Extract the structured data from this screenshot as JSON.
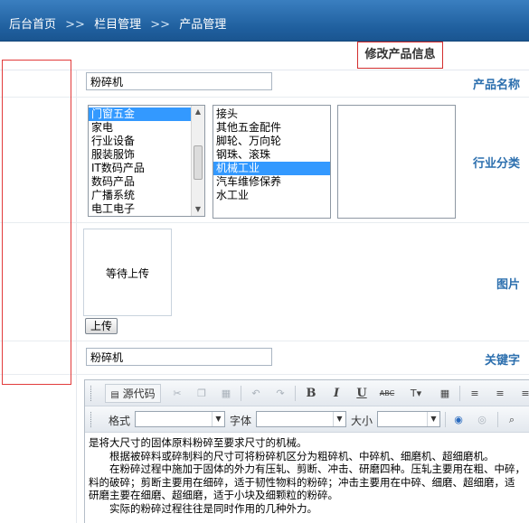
{
  "breadcrumb": {
    "home": "后台首页",
    "sep": ">>",
    "section": "栏目管理",
    "page": "产品管理"
  },
  "page_title": "修改产品信息",
  "fields": {
    "name_label": "产品名称",
    "name_value": "粉碎机",
    "category_label": "行业分类",
    "image_label": "图片",
    "image_placeholder": "等待上传",
    "upload_label": "上传",
    "keyword_label": "关键字",
    "keyword_value": "粉碎机"
  },
  "category_list_1": [
    "门窗五金",
    "家电",
    "行业设备",
    "服装服饰",
    "IT数码产品",
    "数码产品",
    "广播系统",
    "电工电子"
  ],
  "category_list_1_selected": 0,
  "category_list_2": [
    "接头",
    "其他五金配件",
    "脚轮、万向轮",
    "钢珠、滚珠",
    "机械工业",
    "汽车维修保养",
    "水工业"
  ],
  "category_list_2_selected": 4,
  "editor": {
    "source_label": "源代码",
    "format_label": "格式",
    "font_label": "字体",
    "size_label": "大小",
    "content": [
      "是将大尺寸的固体原料粉碎至要求尺寸的机械。",
      "　　根据被碎料或碎制料的尺寸可将粉碎机区分为粗碎机、中碎机、细磨机、超细磨机。",
      "　　在粉碎过程中施加于固体的外力有压轧、剪断、冲击、研磨四种。压轧主要用在粗、中碎，",
      "料的破碎；剪断主要用在细碎，适于韧性物料的粉碎；冲击主要用在中碎、细磨、超细磨，适",
      "研磨主要在细磨、超细磨，适于小块及细颗粒的粉碎。",
      "　　实际的粉碎过程往往是同时作用的几种外力。"
    ]
  }
}
